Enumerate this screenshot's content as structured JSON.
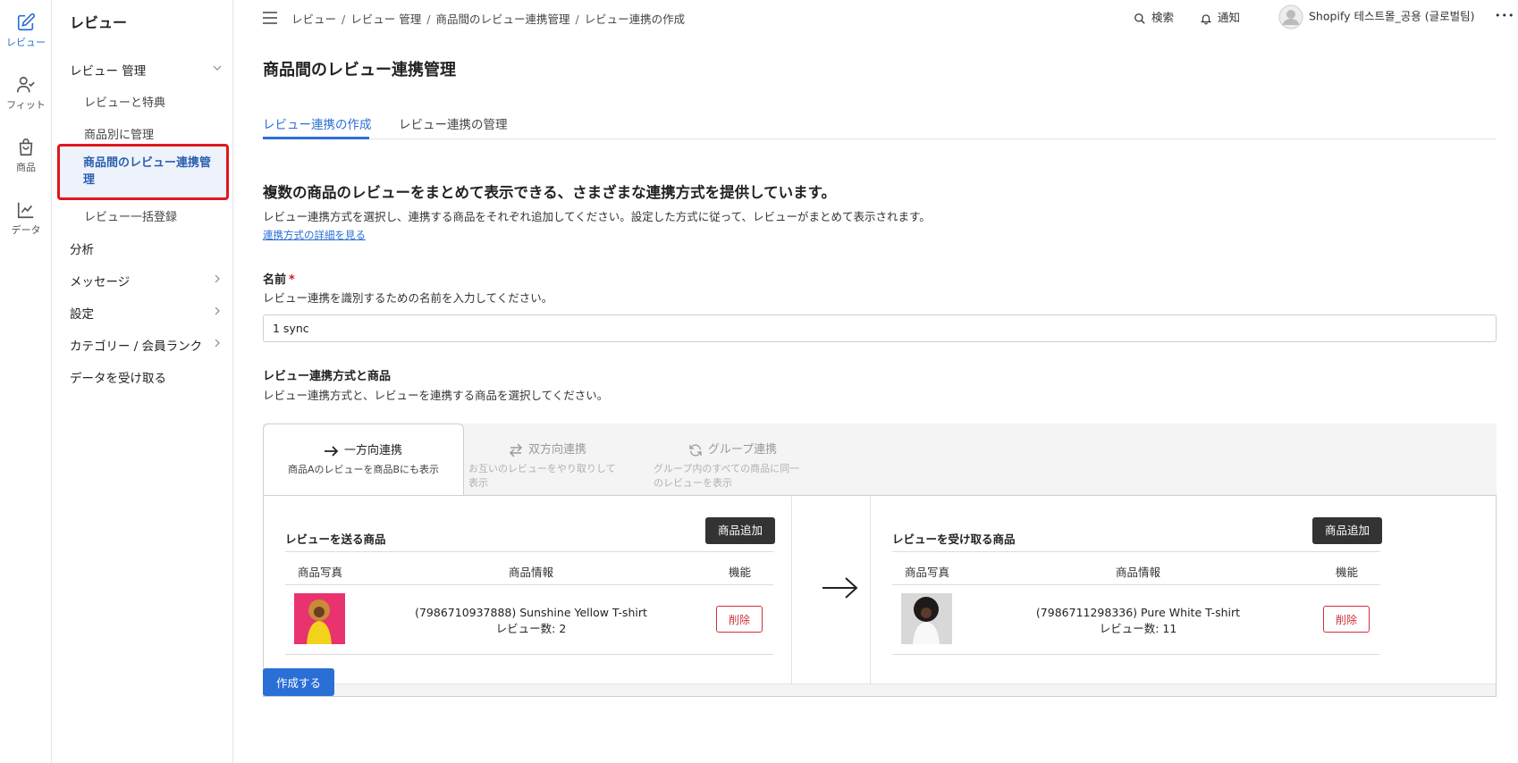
{
  "rail": [
    {
      "label": "レビュー",
      "icon": "edit-icon",
      "active": true
    },
    {
      "label": "フィット",
      "icon": "user-check-icon",
      "active": false
    },
    {
      "label": "商品",
      "icon": "shopping-bag-icon",
      "active": false
    },
    {
      "label": "データ",
      "icon": "line-chart-icon",
      "active": false
    }
  ],
  "sidebar": {
    "title": "レビュー",
    "items": [
      {
        "label": "レビュー 管理"
      },
      {
        "label": "レビューと特典"
      },
      {
        "label": "商品別に管理"
      },
      {
        "label": "商品間のレビュー連携管理"
      },
      {
        "label": "レビュー一括登録"
      },
      {
        "label": "分析"
      },
      {
        "label": "メッセージ"
      },
      {
        "label": "設定"
      },
      {
        "label": "カテゴリー / 会員ランク"
      },
      {
        "label": "データを受け取る"
      }
    ]
  },
  "topbar": {
    "breadcrumbs": [
      "レビュー",
      "レビュー 管理",
      "商品間のレビュー連携管理",
      "レビュー連携の作成"
    ],
    "search_label": "検索",
    "notify_label": "通知",
    "account_name": "Shopify 테스트몰_공용 (글로벌팀)",
    "more_label": "•••"
  },
  "page": {
    "title": "商品間のレビュー連携管理",
    "tabs": [
      {
        "label": "レビュー連携の作成",
        "active": true
      },
      {
        "label": "レビュー連携の管理",
        "active": false
      }
    ],
    "intro_heading": "複数の商品のレビューをまとめて表示できる、さまざまな連携方式を提供しています。",
    "intro_text": "レビュー連携方式を選択し、連携する商品をそれぞれ追加してください。設定した方式に従って、レビューがまとめて表示されます。",
    "intro_link": "連携方式の詳細を見る",
    "name_label": "名前",
    "name_required": "*",
    "name_help": "レビュー連携を識別するための名前を入力してください。",
    "name_value": "1 sync",
    "sync_label": "レビュー連携方式と商品",
    "sync_help": "レビュー連携方式と、レビューを連携する商品を選択してください。",
    "modes": [
      {
        "title": "一方向連携",
        "desc": "商品Aのレビューを商品Bにも表示",
        "icon": "arrow-right-icon",
        "active": true
      },
      {
        "title": "双方向連携",
        "desc": "お互いのレビューをやり取りして表示",
        "icon": "swap-arrows-icon",
        "active": false
      },
      {
        "title": "グループ連携",
        "desc": "グループ内のすべての商品に同一のレビューを表示",
        "icon": "refresh-icon",
        "active": false
      }
    ],
    "sender": {
      "title": "レビューを送る商品",
      "add_label": "商品追加",
      "columns": [
        "商品写真",
        "商品情報",
        "機能"
      ],
      "product": {
        "name": "(7986710937888) Sunshine Yellow T-shirt",
        "reviews": "レビュー数: 2",
        "delete_label": "削除"
      }
    },
    "receiver": {
      "title": "レビューを受け取る商品",
      "add_label": "商品追加",
      "columns": [
        "商品写真",
        "商品情報",
        "機能"
      ],
      "product": {
        "name": "(7986711298336) Pure White T-shirt",
        "reviews": "レビュー数: 11",
        "delete_label": "削除"
      }
    },
    "submit_label": "作成する"
  },
  "colors": {
    "accent": "#2a6fd6",
    "danger": "#d0313a",
    "dark_button": "#333333",
    "highlight_border": "#e0161e"
  }
}
